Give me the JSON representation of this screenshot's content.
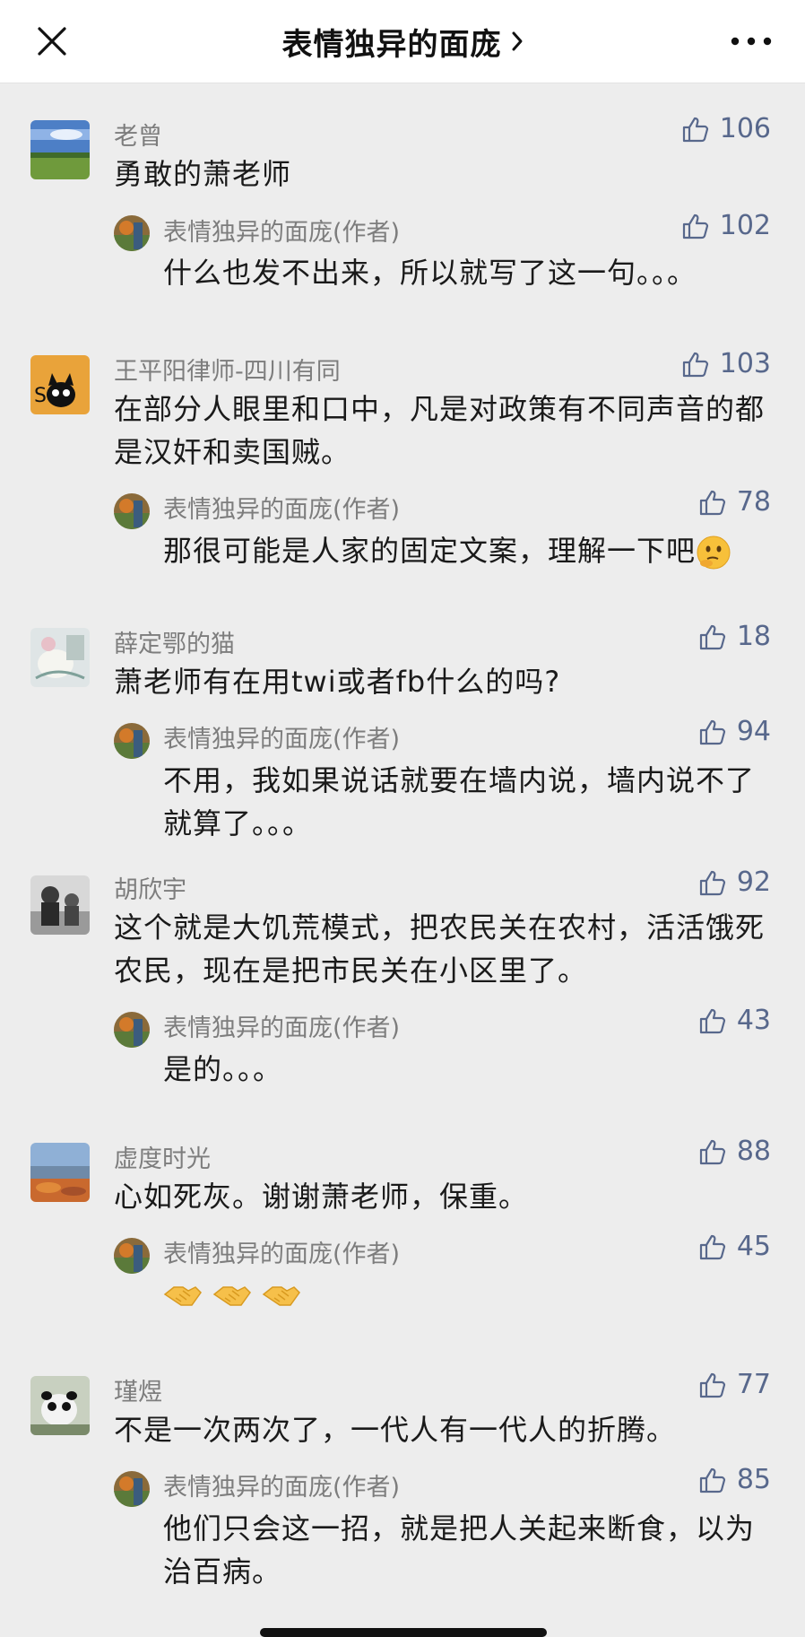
{
  "header": {
    "title": "表情独异的面庞",
    "close_icon": "close-icon",
    "more_icon": "more-icon"
  },
  "comments": [
    {
      "name": "老曾",
      "likes": "106",
      "text": "勇敢的萧老师",
      "reply": {
        "name": "表情独异的面庞(作者)",
        "likes": "102",
        "text": "什么也发不出来，所以就写了这一句。。。"
      }
    },
    {
      "name": "王平阳律师-四川有同",
      "likes": "103",
      "text": "在部分人眼里和口中，凡是对政策有不同声音的都是汉奸和卖国贼。",
      "reply": {
        "name": "表情独异的面庞(作者)",
        "likes": "78",
        "text": "那很可能是人家的固定文案，理解一下吧",
        "emoji": "thinking-face-emoji"
      }
    },
    {
      "name": "薛定鄂的猫",
      "likes": "18",
      "text": "萧老师有在用twi或者fb什么的吗?",
      "reply": {
        "name": "表情独异的面庞(作者)",
        "likes": "94",
        "text": "不用，我如果说话就要在墙内说，墙内说不了就算了。。。"
      }
    },
    {
      "name": "胡欣宇",
      "likes": "92",
      "text": "这个就是大饥荒模式，把农民关在农村，活活饿死农民，现在是把市民关在小区里了。",
      "reply": {
        "name": "表情独异的面庞(作者)",
        "likes": "43",
        "text": "是的。。。"
      }
    },
    {
      "name": "虚度时光",
      "likes": "88",
      "text": "心如死灰。谢谢萧老师，保重。",
      "reply": {
        "name": "表情独异的面庞(作者)",
        "likes": "45",
        "text": "",
        "emoji": "handshake-emoji x3"
      }
    },
    {
      "name": "瑾煜",
      "likes": "77",
      "text": "不是一次两次了，一代人有一代人的折腾。",
      "reply": {
        "name": "表情独异的面庞(作者)",
        "likes": "85",
        "text": "他们只会这一招，就是把人关起来断食，以为治百病。"
      }
    }
  ],
  "colors": {
    "background": "#ededed",
    "name_gray": "#7d7d7d",
    "like_blue": "#58688c",
    "text": "#1a1a1a"
  }
}
